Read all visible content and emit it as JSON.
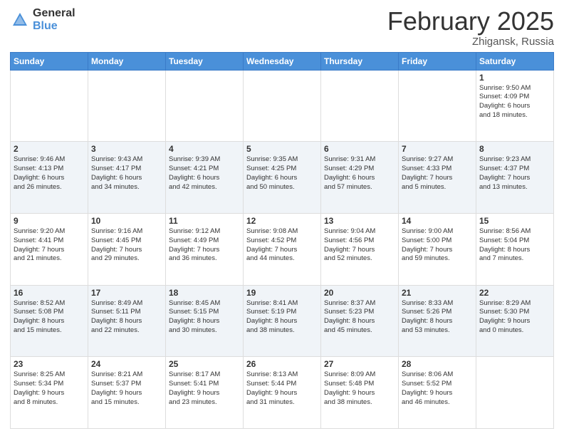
{
  "header": {
    "logo_general": "General",
    "logo_blue": "Blue",
    "month_year": "February 2025",
    "location": "Zhigansk, Russia"
  },
  "weekdays": [
    "Sunday",
    "Monday",
    "Tuesday",
    "Wednesday",
    "Thursday",
    "Friday",
    "Saturday"
  ],
  "weeks": [
    [
      {
        "day": "",
        "info": ""
      },
      {
        "day": "",
        "info": ""
      },
      {
        "day": "",
        "info": ""
      },
      {
        "day": "",
        "info": ""
      },
      {
        "day": "",
        "info": ""
      },
      {
        "day": "",
        "info": ""
      },
      {
        "day": "1",
        "info": "Sunrise: 9:50 AM\nSunset: 4:09 PM\nDaylight: 6 hours\nand 18 minutes."
      }
    ],
    [
      {
        "day": "2",
        "info": "Sunrise: 9:46 AM\nSunset: 4:13 PM\nDaylight: 6 hours\nand 26 minutes."
      },
      {
        "day": "3",
        "info": "Sunrise: 9:43 AM\nSunset: 4:17 PM\nDaylight: 6 hours\nand 34 minutes."
      },
      {
        "day": "4",
        "info": "Sunrise: 9:39 AM\nSunset: 4:21 PM\nDaylight: 6 hours\nand 42 minutes."
      },
      {
        "day": "5",
        "info": "Sunrise: 9:35 AM\nSunset: 4:25 PM\nDaylight: 6 hours\nand 50 minutes."
      },
      {
        "day": "6",
        "info": "Sunrise: 9:31 AM\nSunset: 4:29 PM\nDaylight: 6 hours\nand 57 minutes."
      },
      {
        "day": "7",
        "info": "Sunrise: 9:27 AM\nSunset: 4:33 PM\nDaylight: 7 hours\nand 5 minutes."
      },
      {
        "day": "8",
        "info": "Sunrise: 9:23 AM\nSunset: 4:37 PM\nDaylight: 7 hours\nand 13 minutes."
      }
    ],
    [
      {
        "day": "9",
        "info": "Sunrise: 9:20 AM\nSunset: 4:41 PM\nDaylight: 7 hours\nand 21 minutes."
      },
      {
        "day": "10",
        "info": "Sunrise: 9:16 AM\nSunset: 4:45 PM\nDaylight: 7 hours\nand 29 minutes."
      },
      {
        "day": "11",
        "info": "Sunrise: 9:12 AM\nSunset: 4:49 PM\nDaylight: 7 hours\nand 36 minutes."
      },
      {
        "day": "12",
        "info": "Sunrise: 9:08 AM\nSunset: 4:52 PM\nDaylight: 7 hours\nand 44 minutes."
      },
      {
        "day": "13",
        "info": "Sunrise: 9:04 AM\nSunset: 4:56 PM\nDaylight: 7 hours\nand 52 minutes."
      },
      {
        "day": "14",
        "info": "Sunrise: 9:00 AM\nSunset: 5:00 PM\nDaylight: 7 hours\nand 59 minutes."
      },
      {
        "day": "15",
        "info": "Sunrise: 8:56 AM\nSunset: 5:04 PM\nDaylight: 8 hours\nand 7 minutes."
      }
    ],
    [
      {
        "day": "16",
        "info": "Sunrise: 8:52 AM\nSunset: 5:08 PM\nDaylight: 8 hours\nand 15 minutes."
      },
      {
        "day": "17",
        "info": "Sunrise: 8:49 AM\nSunset: 5:11 PM\nDaylight: 8 hours\nand 22 minutes."
      },
      {
        "day": "18",
        "info": "Sunrise: 8:45 AM\nSunset: 5:15 PM\nDaylight: 8 hours\nand 30 minutes."
      },
      {
        "day": "19",
        "info": "Sunrise: 8:41 AM\nSunset: 5:19 PM\nDaylight: 8 hours\nand 38 minutes."
      },
      {
        "day": "20",
        "info": "Sunrise: 8:37 AM\nSunset: 5:23 PM\nDaylight: 8 hours\nand 45 minutes."
      },
      {
        "day": "21",
        "info": "Sunrise: 8:33 AM\nSunset: 5:26 PM\nDaylight: 8 hours\nand 53 minutes."
      },
      {
        "day": "22",
        "info": "Sunrise: 8:29 AM\nSunset: 5:30 PM\nDaylight: 9 hours\nand 0 minutes."
      }
    ],
    [
      {
        "day": "23",
        "info": "Sunrise: 8:25 AM\nSunset: 5:34 PM\nDaylight: 9 hours\nand 8 minutes."
      },
      {
        "day": "24",
        "info": "Sunrise: 8:21 AM\nSunset: 5:37 PM\nDaylight: 9 hours\nand 15 minutes."
      },
      {
        "day": "25",
        "info": "Sunrise: 8:17 AM\nSunset: 5:41 PM\nDaylight: 9 hours\nand 23 minutes."
      },
      {
        "day": "26",
        "info": "Sunrise: 8:13 AM\nSunset: 5:44 PM\nDaylight: 9 hours\nand 31 minutes."
      },
      {
        "day": "27",
        "info": "Sunrise: 8:09 AM\nSunset: 5:48 PM\nDaylight: 9 hours\nand 38 minutes."
      },
      {
        "day": "28",
        "info": "Sunrise: 8:06 AM\nSunset: 5:52 PM\nDaylight: 9 hours\nand 46 minutes."
      },
      {
        "day": "",
        "info": ""
      }
    ]
  ]
}
